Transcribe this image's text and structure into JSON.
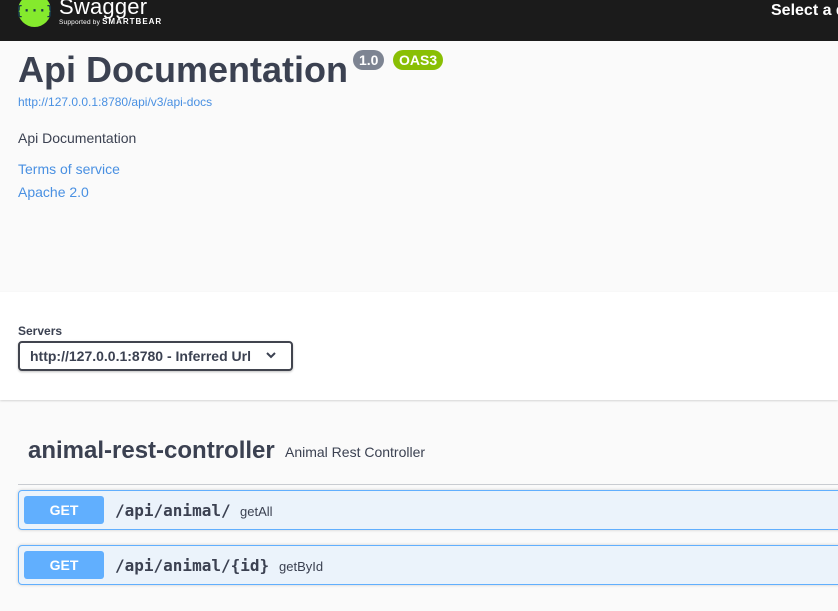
{
  "topbar": {
    "logo_title": "Swagger",
    "logo_sub_prefix": "Supported by",
    "logo_sub_brand": "SMARTBEAR",
    "select_definition": "Select a d"
  },
  "info": {
    "title": "Api Documentation",
    "version": "1.0",
    "oas": "OAS3",
    "url": "http://127.0.0.1:8780/api/v3/api-docs",
    "description": "Api Documentation",
    "terms": "Terms of service",
    "license": "Apache 2.0"
  },
  "servers": {
    "label": "Servers",
    "selected": "http://127.0.0.1:8780 - Inferred Url"
  },
  "tag": {
    "name": "animal-rest-controller",
    "description": "Animal Rest Controller"
  },
  "operations": [
    {
      "method": "GET",
      "path": "/api/animal/",
      "summary": "getAll"
    },
    {
      "method": "GET",
      "path": "/api/animal/{id}",
      "summary": "getById"
    }
  ],
  "colors": {
    "topbar": "#1b1b1b",
    "logo": "#85ea2d",
    "get_method": "#61affe",
    "get_bg": "#ebf3fb",
    "link": "#4990e2",
    "text": "#3b4151"
  }
}
